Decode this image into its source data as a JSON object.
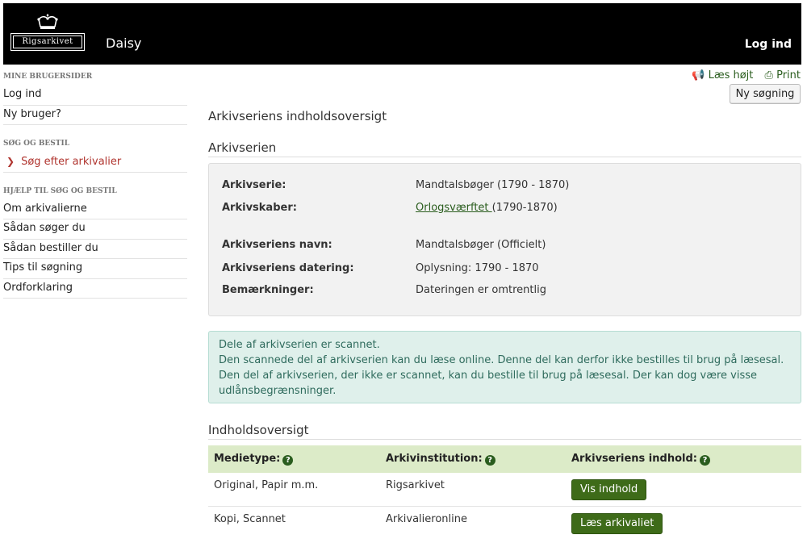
{
  "header": {
    "logo_text": "Rigsarkivet",
    "app_name": "Daisy",
    "login_label": "Log ind"
  },
  "sidebar": {
    "sections": [
      {
        "heading": "Mine brugersider",
        "items": [
          "Log ind",
          "Ny bruger?"
        ]
      },
      {
        "heading": "Søg og bestil",
        "items": [
          "Søg efter arkivalier"
        ]
      },
      {
        "heading": "Hjælp til søg og bestil",
        "items": [
          "Om arkivalierne",
          "Sådan søger du",
          "Sådan bestiller du",
          "Tips til søgning",
          "Ordforklaring"
        ]
      }
    ]
  },
  "toolbar": {
    "read_aloud": "Læs højt",
    "print": "Print",
    "new_search": "Ny søgning"
  },
  "page_title": "Arkivseriens indholdsoversigt",
  "series_section": {
    "title": "Arkivserien",
    "rows": [
      {
        "label": "Arkivserie:",
        "value": "Mandtalsbøger (1790 - 1870)"
      },
      {
        "label": "Arkivskaber:",
        "link": "Orlogsværftet ",
        "value": "(1790-1870)"
      },
      {
        "label": "Arkivseriens navn:",
        "value": "Mandtalsbøger (Officielt)"
      },
      {
        "label": "Arkivseriens datering:",
        "value": "Oplysning: 1790 - 1870"
      },
      {
        "label": "Bemærkninger:",
        "value": "Dateringen er omtrentlig"
      }
    ]
  },
  "notice": {
    "line1": "Dele af arkivserien er scannet.",
    "line2": "Den scannede del af arkivserien kan du læse online. Denne del kan derfor ikke bestilles til brug på læsesal. Den del af arkivserien, der ikke er scannet, kan du bestille til brug på læsesal. Der kan dog være visse udlånsbegrænsninger."
  },
  "contents": {
    "title": "Indholdsoversigt",
    "headers": [
      "Medietype:",
      "Arkivinstitution:",
      "Arkivseriens indhold:"
    ],
    "rows": [
      {
        "medium": "Original, Papir m.m.",
        "institution": "Rigsarkivet",
        "action": "Vis indhold"
      },
      {
        "medium": "Kopi, Scannet",
        "institution": "Arkivalieronline",
        "action": "Læs arkivaliet"
      }
    ]
  },
  "colors": {
    "header_bg": "#000000",
    "accent_green": "#3e6b19",
    "active_red": "#b0352f",
    "notice_bg": "#dff0eb",
    "table_head_bg": "#dcebc8"
  }
}
